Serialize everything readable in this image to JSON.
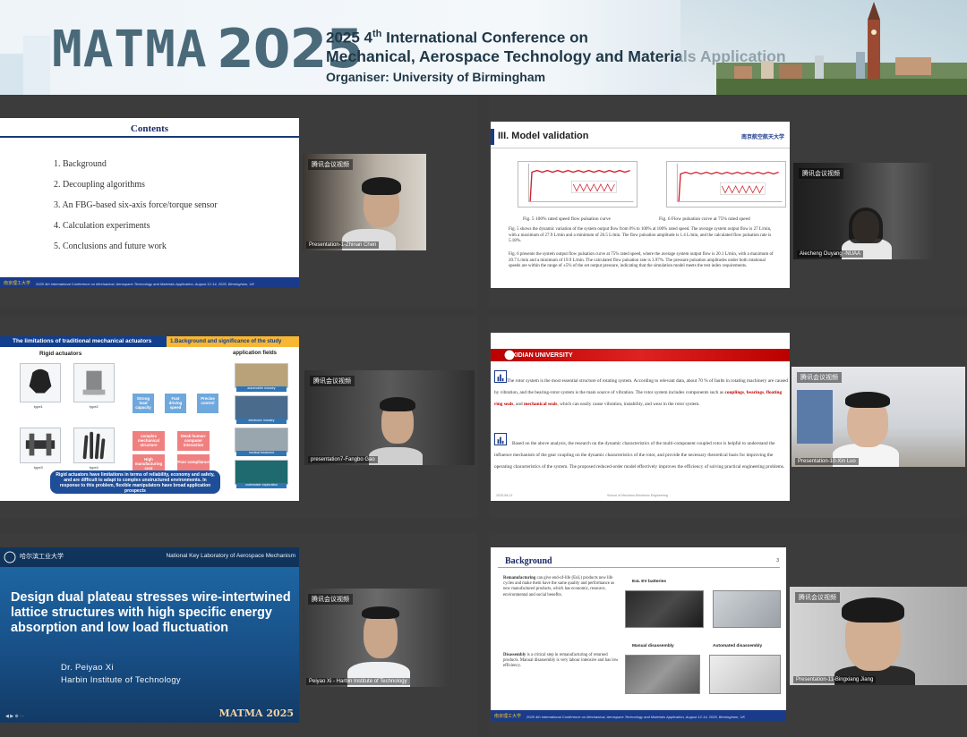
{
  "banner": {
    "logo": "MATMA",
    "year": "2025",
    "line1_pre": "2025 4",
    "line1_sup": "th",
    "line1_post": " International Conference on",
    "line2": "Mechanical, Aerospace Technology and Materials Application",
    "line3": "Organiser: University of Birmingham"
  },
  "camera_tag": "腾讯会议视频",
  "panels": {
    "p1": {
      "slide_title": "Contents",
      "items": [
        "1. Background",
        "2. Decoupling algorithms",
        "3. An FBG-based six-axis force/torque sensor",
        "4. Calculation experiments",
        "5. Conclusions and future work"
      ],
      "footer_logo": "南京理工大学",
      "footer": "2025 4th International Conference on Mechanical, Aerospace Technology and Materials Application, August 12-14, 2025, Birmingham, UK",
      "cam_name": "Presentation-1-Zhinan Chen"
    },
    "p2": {
      "slide_title": "III. Model validation",
      "logo": "南京航空航天大学",
      "cap1": "Fig. 5  100% rated speed flow pulsation curve",
      "cap2": "Fig. 6   Flow pulsation curve at 75% rated speed",
      "para1": "Fig. 5 shows the dynamic variation of the system output flow from 0% to 100% at 100% rated speed. The average system output flow is 27 L/min, with a maximum of 27.9 L/min and a minimum of 26.5 L/min. The flow pulsation amplitude is 1.4 L/min, and the calculated flow pulsation rate is 5.18%.",
      "para2": "Fig. 6 presents the system output flow pulsation curve at 75% rated speed, where the average system output flow is 20.1 L/min, with a maximum of 20.7 L/min and a minimum of 19.9 L/min. The calculated flow pulsation rate is 3.97%. The pressure pulsation amplitudes under both rotational speeds are within the range of ±5% of the set output pressure, indicating that the simulation model meets the test index requirements.",
      "cam_name": "Aiecheng Ouyang -NUAA"
    },
    "p3": {
      "head": "The limitations of traditional mechanical actuators",
      "tag": "1.Background and significance of the study",
      "rigid": "Rigid  actuators",
      "app_fields": "application fields",
      "types": [
        "type1",
        "type2",
        "type3",
        "type4"
      ],
      "blue": [
        "Strong load capacity",
        "Fast driving speed",
        "Precise control"
      ],
      "red": [
        "complex mechanical structure",
        "Weak human-computer interaction",
        "High manufacturing cost",
        "Poor compliance"
      ],
      "fields": [
        "automobile industry",
        "electronic industry",
        "medical treatment",
        "underwater exploration"
      ],
      "note": "Rigid actuators have limitations in terms of reliability, economy and safety, and are difficult to adapt to complex unstructured environments. In response to this problem, flexible manipulators have broad application prospects",
      "cam_name": "presentation7-Fangbo Gao"
    },
    "p4": {
      "unit": "XIDIAN UNIVERSITY",
      "para1_a": "The rotor system is the most essential structure of rotating system. According to relevant data, about 70 % of faults in rotating machinery are caused by vibration, and the bearing-rotor system is the main source of vibration. The rotor system includes components such as ",
      "kw1": "couplings",
      "kw2": "bearings",
      "kw3": "floating ring seals",
      "kw4": "mechanical seals",
      "para1_b": ", which can easily cause vibration, instability, and wear in the rotor system.",
      "para2": "Based on the above analysis, the research on the dynamic characteristics of the multi-component coupled rotor is helpful to understand the influence mechanism of the gear coupling on the dynamic characteristics of the rotor, and provide the necessary theoretical basis for improving the operating characteristics of the system. The proposed reduced-order model effectively improves the efficiency of solving practical engineering problems.",
      "footer_left": "2025-08-13",
      "footer_mid": "School of Mechano-Electronic Engineering",
      "cam_name": "Presentation-10-Xin Luo"
    },
    "p5": {
      "harbin": "哈尔滨工业大学",
      "lab": "National Key Laboratory of Aerospace Mechanism",
      "title": "Design dual plateau stresses wire-intertwined lattice structures with high specific energy absorption and low load fluctuation",
      "author": "Dr. Peiyao Xi",
      "inst": "Harbin Institute of Technology",
      "wm": "MATMA 2025",
      "cam_name": "Peiyao Xi - Harbin Institute of Technology"
    },
    "p6": {
      "title": "Background",
      "page": "3",
      "b1_head": "Remanufacturing",
      "b1": " can give end-of-life (EoL) products new life cycles and make them have the same quality and performance as new manufactured products, which has economic, resource, environmental and social benefits.",
      "b2_head": "Disassembly",
      "b2": " is a critical step in remanufacturing of returned products. Manual disassembly is very labour intensive and has low efficiency.",
      "lbl1": "EoL EV batteries",
      "lbl2": "Manual disassembly",
      "lbl3": "Automated disassembly",
      "footer_logo": "南京理工大学",
      "footer": "2025 4th International Conference on Mechanical, Aerospace Technology and Materials Application, August 12-14, 2025, Birmingham, UK",
      "cam_name": "Presentation-11-Bingxiang Jiang"
    }
  }
}
